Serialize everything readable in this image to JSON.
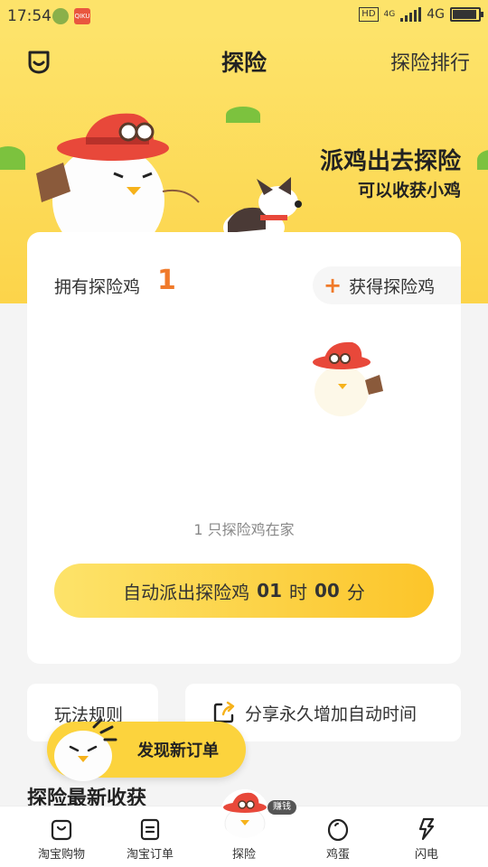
{
  "status_bar": {
    "time": "17:54",
    "app_badge": "QIKU",
    "hd": "HD",
    "network": "4G",
    "network_small": "4G"
  },
  "header": {
    "title": "探险",
    "rank_link": "探险排行"
  },
  "hero": {
    "slogan_line1": "派鸡出去探险",
    "slogan_line2": "可以收获小鸡"
  },
  "card": {
    "owned_label": "拥有探险鸡",
    "owned_count": "1",
    "get_button_plus": "+",
    "get_button_label": "获得探险鸡",
    "home_status": "1 只探险鸡在家",
    "auto_dispatch": {
      "prefix": "自动派出探险鸡",
      "hours": "01",
      "hours_unit": "时",
      "minutes": "00",
      "minutes_unit": "分"
    }
  },
  "actions": {
    "rules_label": "玩法规则",
    "share_label": "分享永久增加自动时间"
  },
  "floating": {
    "label": "发现新订单"
  },
  "section": {
    "title": "探险最新收获"
  },
  "tabbar": {
    "items": [
      {
        "label": "淘宝购物",
        "icon": "shopping-bag-icon"
      },
      {
        "label": "淘宝订单",
        "icon": "order-list-icon"
      },
      {
        "label": "探险",
        "icon": "explorer-chick-icon"
      },
      {
        "label": "鸡蛋",
        "icon": "egg-icon"
      },
      {
        "label": "闪电",
        "icon": "lightning-icon"
      }
    ],
    "center_badge": "赚钱"
  },
  "colors": {
    "accent_yellow": "#fcd33d",
    "count_orange": "#f07a2a",
    "hill_green": "#7cc23e"
  }
}
